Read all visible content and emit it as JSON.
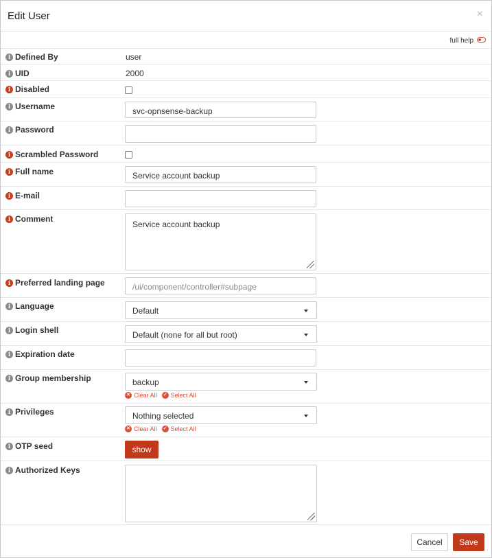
{
  "dialog": {
    "title": "Edit User",
    "close": "×",
    "full_help_label": "full help"
  },
  "colors": {
    "accent": "#c0391b",
    "info_red": "#c1401d",
    "info_grey": "#8a8a8a"
  },
  "fields": {
    "defined_by": {
      "label": "Defined By",
      "value": "user"
    },
    "uid": {
      "label": "UID",
      "value": "2000"
    },
    "disabled": {
      "label": "Disabled",
      "checked": false
    },
    "username": {
      "label": "Username",
      "value": "svc-opnsense-backup"
    },
    "password": {
      "label": "Password",
      "value": ""
    },
    "scrambled_password": {
      "label": "Scrambled Password",
      "checked": false
    },
    "full_name": {
      "label": "Full name",
      "value": "Service account backup"
    },
    "email": {
      "label": "E-mail",
      "value": ""
    },
    "comment": {
      "label": "Comment",
      "value": "Service account backup"
    },
    "landing_page": {
      "label": "Preferred landing page",
      "placeholder": "/ui/component/controller#subpage"
    },
    "language": {
      "label": "Language",
      "value": "Default"
    },
    "login_shell": {
      "label": "Login shell",
      "value": "Default (none for all but root)"
    },
    "expiration_date": {
      "label": "Expiration date",
      "value": ""
    },
    "group_membership": {
      "label": "Group membership",
      "value": "backup",
      "clear_all": "Clear All",
      "select_all": "Select All"
    },
    "privileges": {
      "label": "Privileges",
      "value": "Nothing selected",
      "clear_all": "Clear All",
      "select_all": "Select All"
    },
    "otp_seed": {
      "label": "OTP seed",
      "button": "show"
    },
    "authorized_keys": {
      "label": "Authorized Keys",
      "value": ""
    }
  },
  "footer": {
    "cancel": "Cancel",
    "save": "Save"
  }
}
